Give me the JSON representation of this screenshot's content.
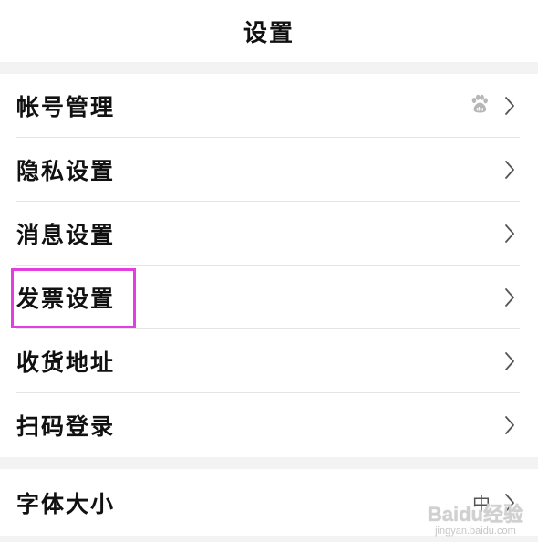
{
  "header": {
    "title": "设置"
  },
  "group1": {
    "items": [
      {
        "label": "帐号管理",
        "badge_icon": "baidu-paw-icon"
      },
      {
        "label": "隐私设置"
      },
      {
        "label": "消息设置"
      },
      {
        "label": "发票设置",
        "highlighted": true,
        "highlight_color": "#e23ee0"
      },
      {
        "label": "收货地址"
      },
      {
        "label": "扫码登录"
      }
    ]
  },
  "group2": {
    "items": [
      {
        "label": "字体大小",
        "value": "中"
      }
    ]
  },
  "watermark": {
    "logo_text": "Baidu经验",
    "url": "jingyan.baidu.com"
  },
  "icons": {
    "chevron": "chevron-right-icon",
    "account_badge": "baidu-paw-icon"
  }
}
